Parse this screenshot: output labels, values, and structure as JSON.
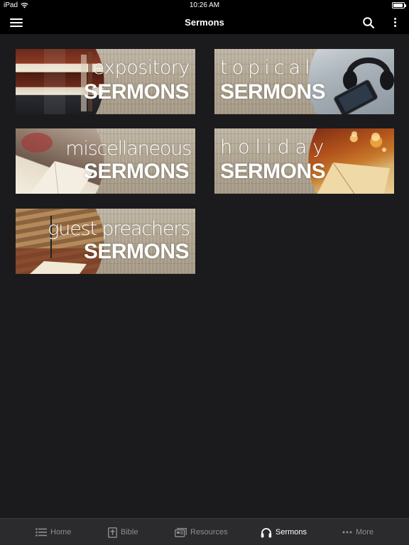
{
  "status": {
    "device": "iPad",
    "time": "10:26 AM",
    "battery_level": 0.9
  },
  "nav": {
    "title": "Sermons"
  },
  "cards": [
    {
      "line1": "expository",
      "line2": "SERMONS"
    },
    {
      "line1": "topical",
      "line2": "SERMONS"
    },
    {
      "line1": "miscellaneous",
      "line2": "SERMONS"
    },
    {
      "line1": "holiday",
      "line2": "SERMONS"
    },
    {
      "line1": "guest preachers",
      "line2": "SERMONS"
    }
  ],
  "tabs": [
    {
      "label": "Home",
      "icon": "list-icon"
    },
    {
      "label": "Bible",
      "icon": "bible-icon"
    },
    {
      "label": "Resources",
      "icon": "resources-icon"
    },
    {
      "label": "Sermons",
      "icon": "headphones-icon",
      "active": true
    },
    {
      "label": "More",
      "icon": "ellipsis-icon"
    }
  ],
  "colors": {
    "background": "#1b1b1d",
    "bar": "#000000",
    "tab_bar": "#2b2b2d",
    "tab_inactive": "#8e8e93",
    "tab_active": "#ffffff"
  }
}
